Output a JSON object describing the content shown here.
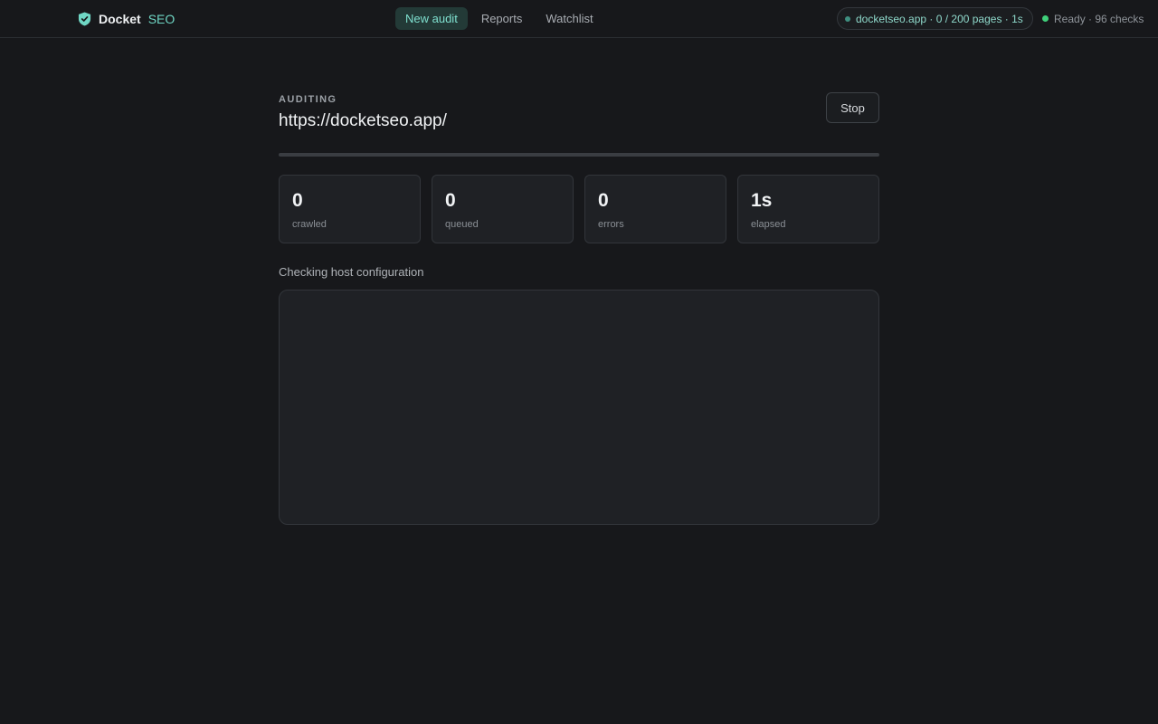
{
  "brand": {
    "name": "Docket",
    "suffix": "SEO",
    "icon": "shield-icon"
  },
  "nav": {
    "tabs": [
      {
        "label": "New audit",
        "active": true
      },
      {
        "label": "Reports",
        "active": false
      },
      {
        "label": "Watchlist",
        "active": false
      }
    ]
  },
  "status": {
    "pill": "docketseo.app · 0 / 200 pages · 1s",
    "ready": "Ready · 96 checks"
  },
  "audit": {
    "eyebrow": "AUDITING",
    "url": "https://docketseo.app/",
    "stop_label": "Stop",
    "progress_fraction": 0,
    "phase": "Checking host configuration"
  },
  "stats": [
    {
      "value": "0",
      "label": "crawled"
    },
    {
      "value": "0",
      "label": "queued"
    },
    {
      "value": "0",
      "label": "errors"
    },
    {
      "value": "1s",
      "label": "elapsed"
    }
  ],
  "colors": {
    "accent": "#6fd6c4",
    "ready": "#3fcf7a",
    "background": "#17181b"
  }
}
